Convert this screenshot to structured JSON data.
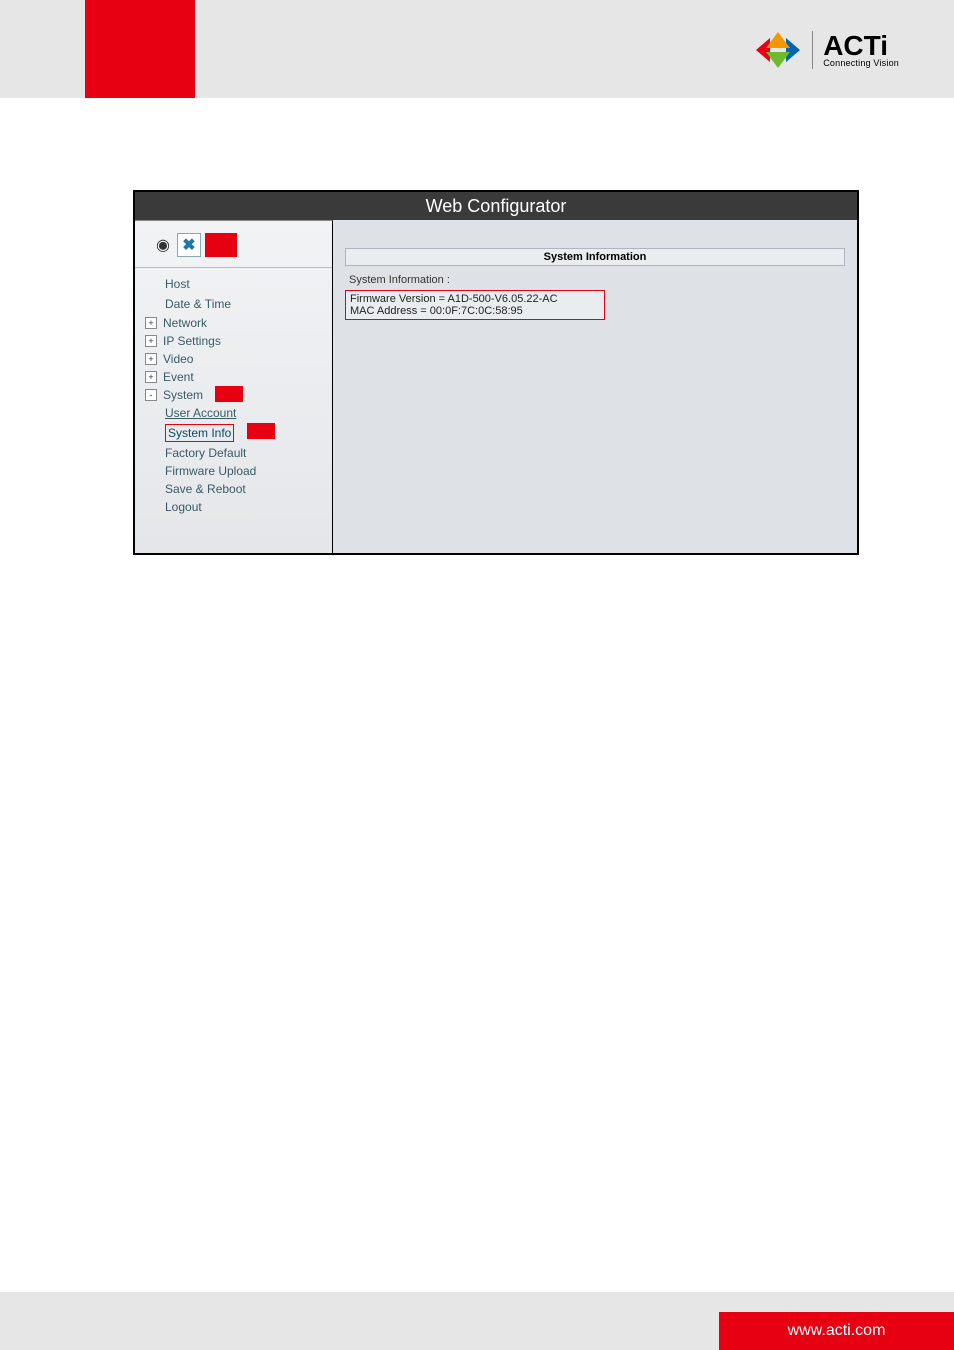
{
  "brand": {
    "name": "ACTi",
    "tagline": "Connecting Vision"
  },
  "footer_url": "www.acti.com",
  "configurator": {
    "title": "Web Configurator",
    "sidebar": {
      "icons": {
        "camera": "camera-icon",
        "tool": "tool-icon"
      },
      "top_items": [
        "Host",
        "Date & Time"
      ],
      "groups": [
        {
          "label": "Network",
          "expanded": false
        },
        {
          "label": "IP Settings",
          "expanded": false
        },
        {
          "label": "Video",
          "expanded": false
        },
        {
          "label": "Event",
          "expanded": false
        },
        {
          "label": "System",
          "expanded": true,
          "children": [
            "User Account",
            "System Info",
            "Factory Default",
            "Firmware Upload",
            "Save & Reboot",
            "Logout"
          ]
        }
      ],
      "selected": "System Info"
    },
    "content": {
      "panel_title": "System Information",
      "section_label": "System Information :",
      "firmware_line": "Firmware Version = A1D-500-V6.05.22-AC",
      "mac_line": "MAC Address = 00:0F:7C:0C:58:95"
    }
  }
}
